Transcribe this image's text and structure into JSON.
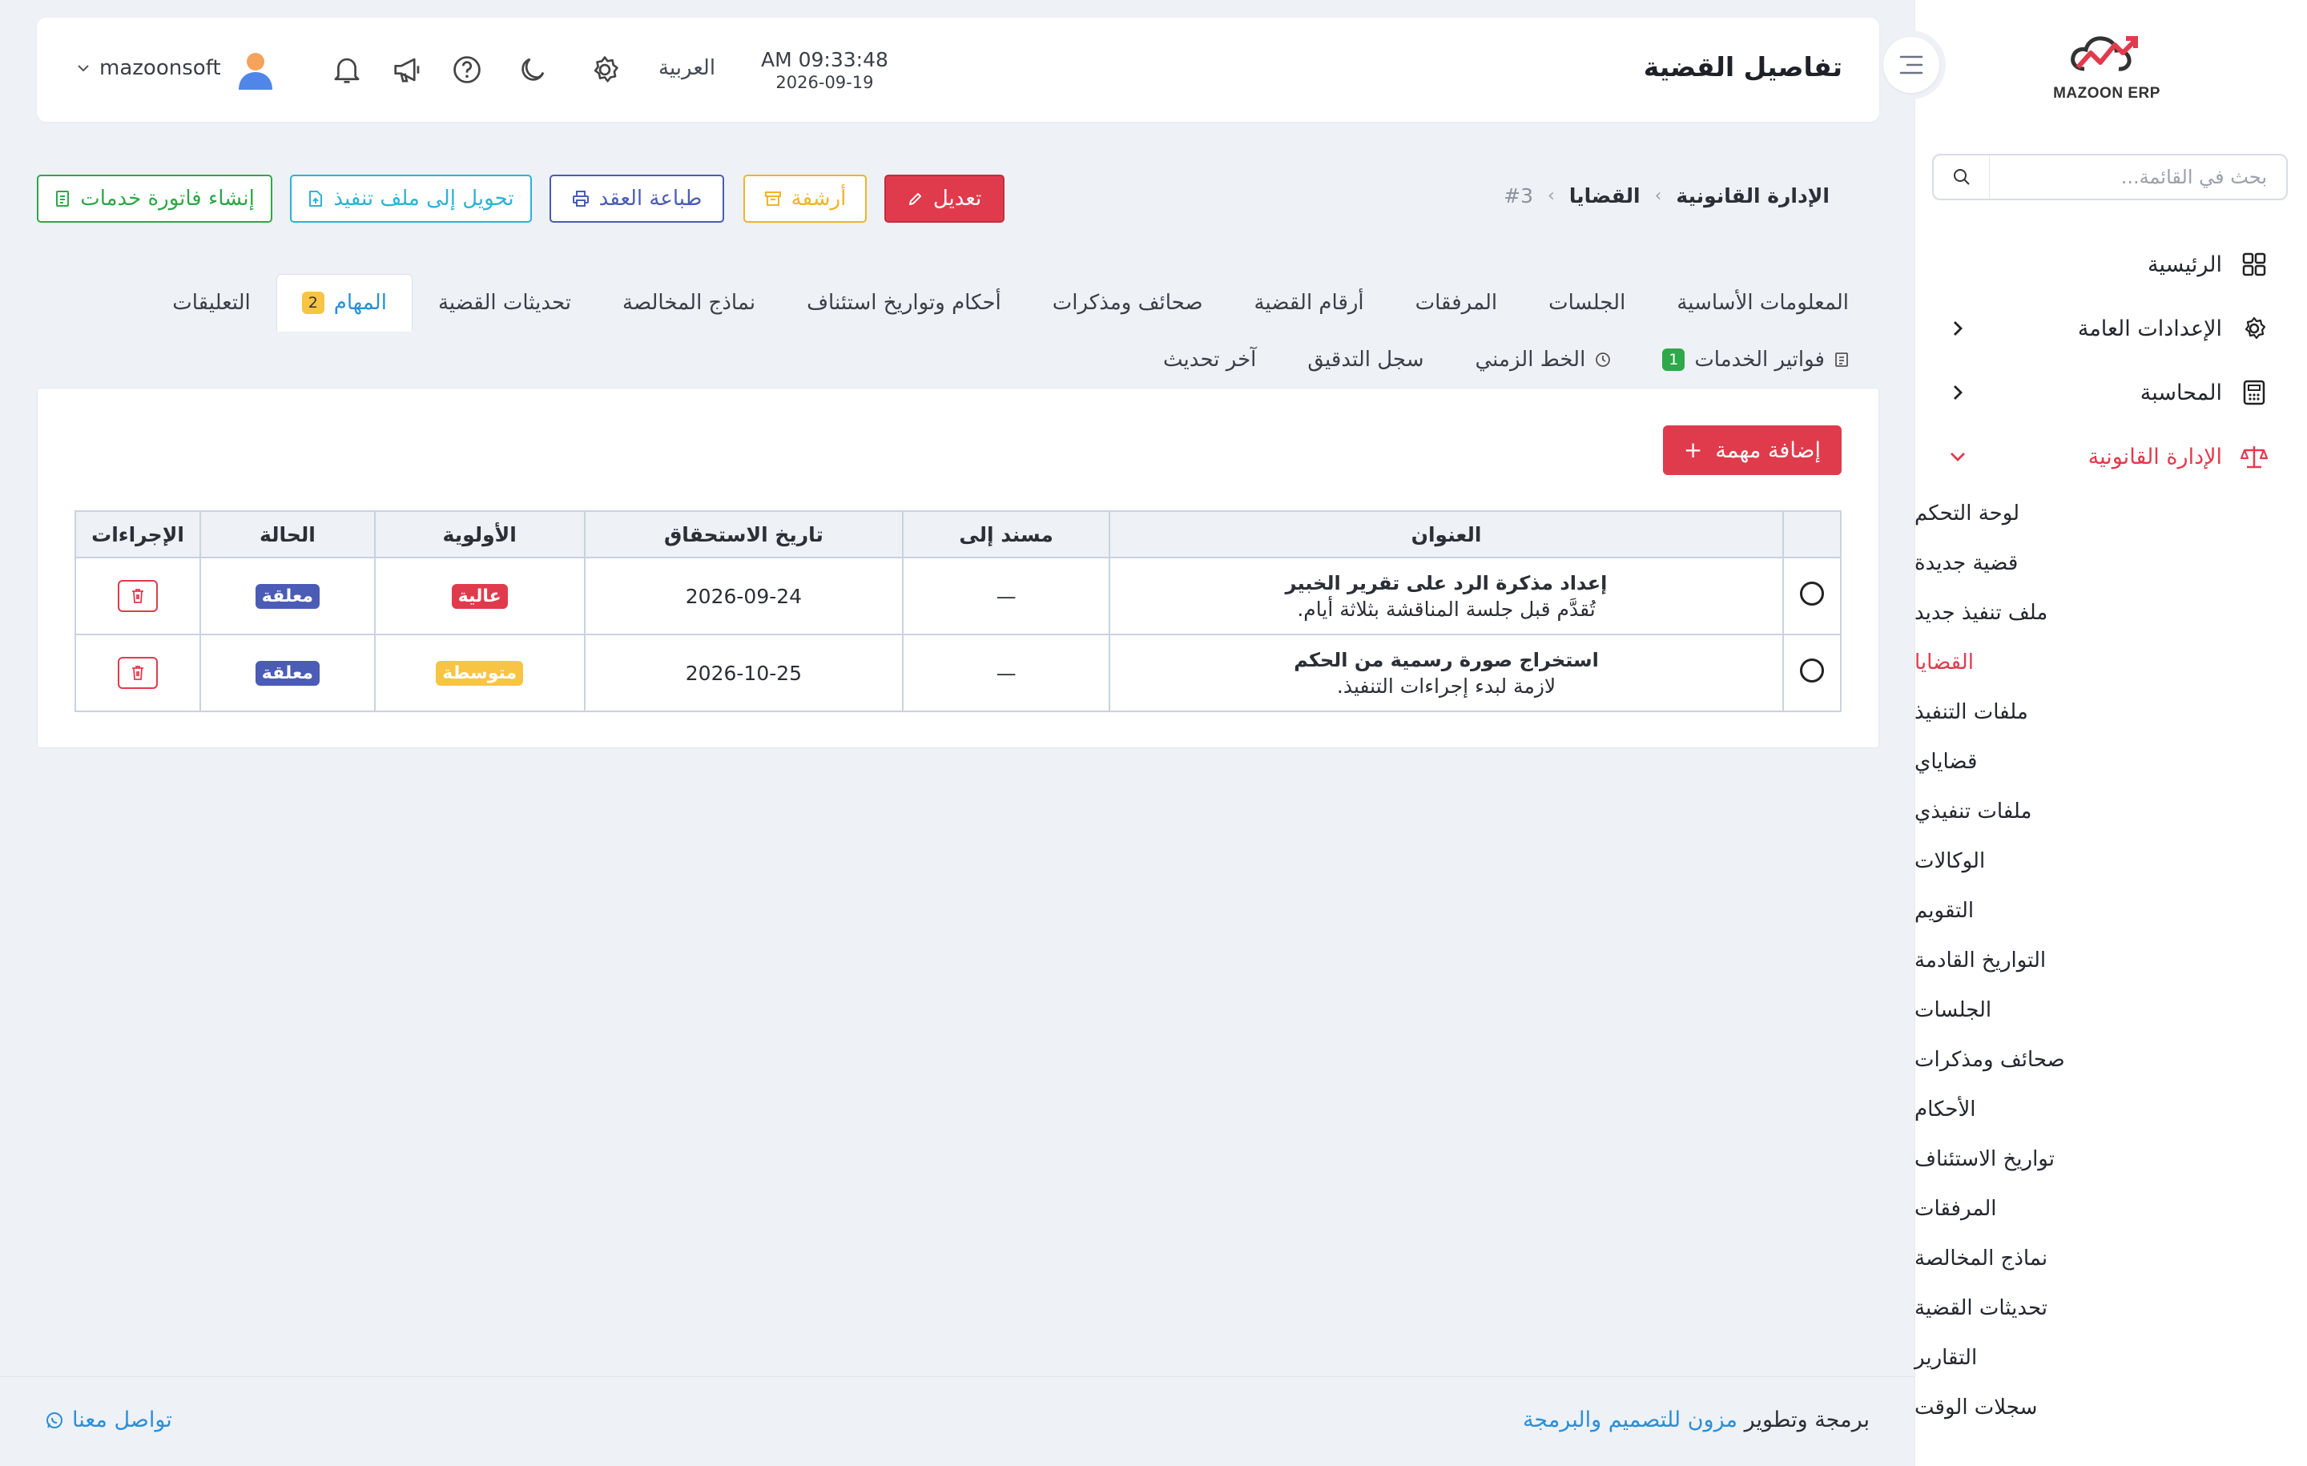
{
  "app": {
    "logo_text": "MAZOON ERP",
    "page_title": "تفاصيل القضية"
  },
  "header": {
    "time": "AM 09:33:48",
    "date": "2026-09-19",
    "language": "العربية",
    "username": "mazoonsoft",
    "icons": [
      "gear-icon",
      "moon-icon",
      "help-icon",
      "megaphone-icon",
      "bell-icon"
    ]
  },
  "sidebar": {
    "search_placeholder": "بحث في القائمة...",
    "items": [
      {
        "label": "الرئيسية",
        "icon": "grid-icon"
      },
      {
        "label": "الإعدادات العامة",
        "icon": "gear-icon"
      },
      {
        "label": "المحاسبة",
        "icon": "calculator-icon"
      },
      {
        "label": "الإدارة القانونية",
        "icon": "scales-icon"
      }
    ],
    "sub_items": [
      "لوحة التحكم",
      "قضية جديدة",
      "ملف تنفيذ جديد",
      "القضايا",
      "ملفات التنفيذ",
      "قضاياي",
      "ملفات تنفيذي",
      "الوكالات",
      "التقويم",
      "التواريخ القادمة",
      "الجلسات",
      "صحائف ومذكرات",
      "الأحكام",
      "تواريخ الاستئناف",
      "المرفقات",
      "نماذج المخالصة",
      "تحديثات القضية",
      "التقارير",
      "سجلات الوقت"
    ],
    "active_sub": "القضايا"
  },
  "breadcrumb": {
    "root": "الإدارة القانونية",
    "section": "القضايا",
    "current": "#3"
  },
  "actions": {
    "edit": "تعديل",
    "archive": "أرشفة",
    "print_contract": "طباعة العقد",
    "convert_execution": "تحويل إلى ملف تنفيذ",
    "create_invoice": "إنشاء فاتورة خدمات"
  },
  "tabs": {
    "row1": [
      {
        "label": "المعلومات الأساسية"
      },
      {
        "label": "الجلسات"
      },
      {
        "label": "المرفقات"
      },
      {
        "label": "أرقام القضية"
      },
      {
        "label": "صحائف ومذكرات"
      },
      {
        "label": "أحكام وتواريخ استئناف"
      },
      {
        "label": "نماذج المخالصة"
      },
      {
        "label": "تحديثات القضية"
      },
      {
        "label": "المهام",
        "badge": "2"
      },
      {
        "label": "التعليقات"
      }
    ],
    "row2": [
      {
        "label": "فواتير الخدمات",
        "badge": "1"
      },
      {
        "label": "الخط الزمني"
      },
      {
        "label": "سجل التدقيق"
      },
      {
        "label": "آخر تحديث"
      }
    ],
    "active": "المهام"
  },
  "tasks": {
    "add_button": "إضافة مهمة",
    "columns": [
      "العنوان",
      "مسند إلى",
      "تاريخ الاستحقاق",
      "الأولوية",
      "الحالة",
      "الإجراءات"
    ],
    "rows": [
      {
        "title": "إعداد مذكرة الرد على تقرير الخبير",
        "desc": "تُقدَّم قبل جلسة المناقشة بثلاثة أيام.",
        "assignee": "—",
        "due": "2026-09-24",
        "priority": "عالية",
        "priority_color": "#e03b4c",
        "status": "معلقة",
        "status_color": "#4a5cb5"
      },
      {
        "title": "استخراج صورة رسمية من الحكم",
        "desc": "لازمة لبدء إجراءات التنفيذ.",
        "assignee": "—",
        "due": "2026-10-25",
        "priority": "متوسطة",
        "priority_color": "#f7c443",
        "status": "معلقة",
        "status_color": "#4a5cb5"
      }
    ]
  },
  "footer": {
    "credit_prefix": "برمجة وتطوير",
    "credit_link": "مزون للتصميم والبرمجة",
    "contact": "تواصل معنا"
  },
  "colors": {
    "accent_red": "#e03b4c",
    "link_blue": "#2b8fd6",
    "archive_yellow": "#f0b429",
    "print_indigo": "#4a5cb5",
    "convert_cyan": "#2bb3d6",
    "invoice_green": "#2ea84a"
  }
}
